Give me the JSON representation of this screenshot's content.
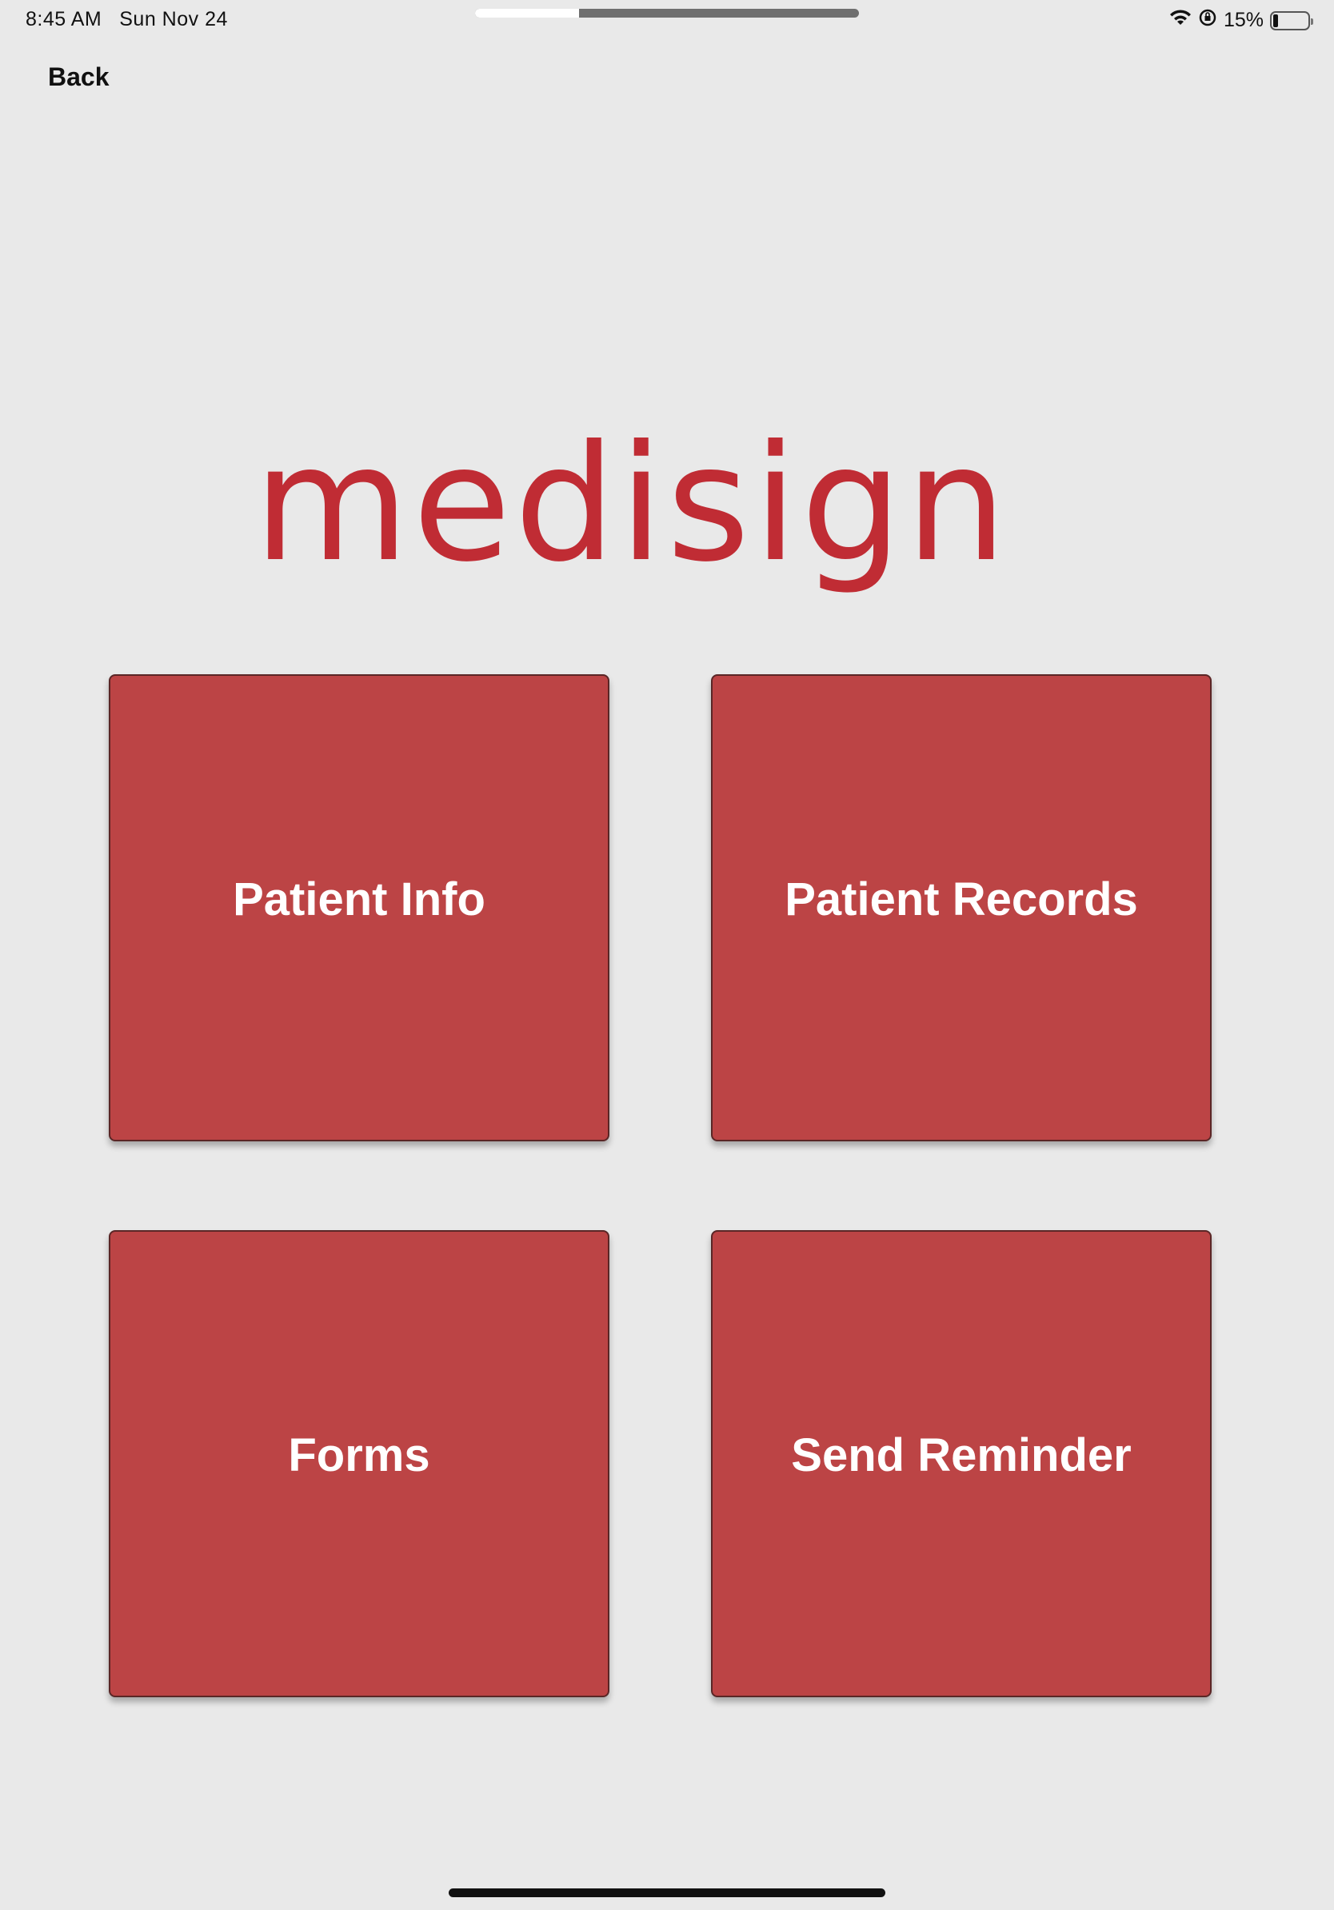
{
  "status_bar": {
    "time": "8:45 AM",
    "date": "Sun Nov 24",
    "battery": "15%",
    "battery_level": 0.15,
    "icons": [
      "wifi-icon",
      "orientation-lock-icon",
      "battery-icon"
    ]
  },
  "nav": {
    "back_label": "Back"
  },
  "logo": {
    "text": "medisign",
    "color": "#c02c34"
  },
  "tiles": [
    {
      "label": "Patient Info"
    },
    {
      "label": "Patient Records"
    },
    {
      "label": "Forms"
    },
    {
      "label": "Send Reminder"
    }
  ],
  "colors": {
    "background": "#e9e9e9",
    "tile": "#bc4445",
    "tile_text": "#ffffff"
  }
}
